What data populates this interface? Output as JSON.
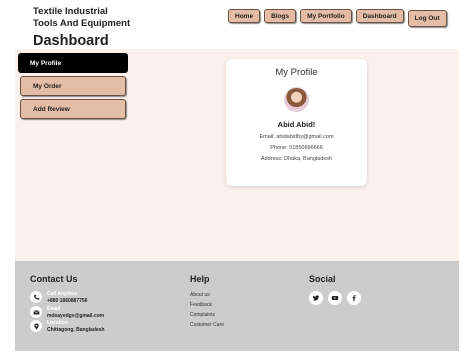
{
  "header": {
    "brand_line1": "Textile Industrial",
    "brand_line2": "Tools And Equipment",
    "page_title": "Dashboard",
    "nav": {
      "home": "Home",
      "blogs": "Blogs",
      "portfolio": "My Portfolio",
      "dashboard": "Dashboard",
      "logout": "Log Out"
    }
  },
  "sidebar": {
    "items": [
      {
        "label": "My Profile"
      },
      {
        "label": "My Order"
      },
      {
        "label": "Add Review"
      }
    ]
  },
  "profile": {
    "title": "My Profile",
    "name": "Abid Abid!",
    "email": "Email: abidabidby@gmail.com",
    "phone": "Phone: 01850666666",
    "address": "Address: Dhaka, Bangladesh"
  },
  "footer": {
    "contact": {
      "title": "Contact Us",
      "call_label": "Call Anytime",
      "call_value": "+880 1860887756",
      "email_label": "Email",
      "email_value": "mdsayedgv@gmail.com",
      "location_label": "Location",
      "location_value": "Chittagong, Bangladesh"
    },
    "help": {
      "title": "Help",
      "links": [
        "About us",
        "Feedback",
        "Complaints",
        "Customer Care"
      ]
    },
    "social": {
      "title": "Social",
      "icons": [
        "twitter-icon",
        "youtube-icon",
        "facebook-icon"
      ]
    }
  }
}
